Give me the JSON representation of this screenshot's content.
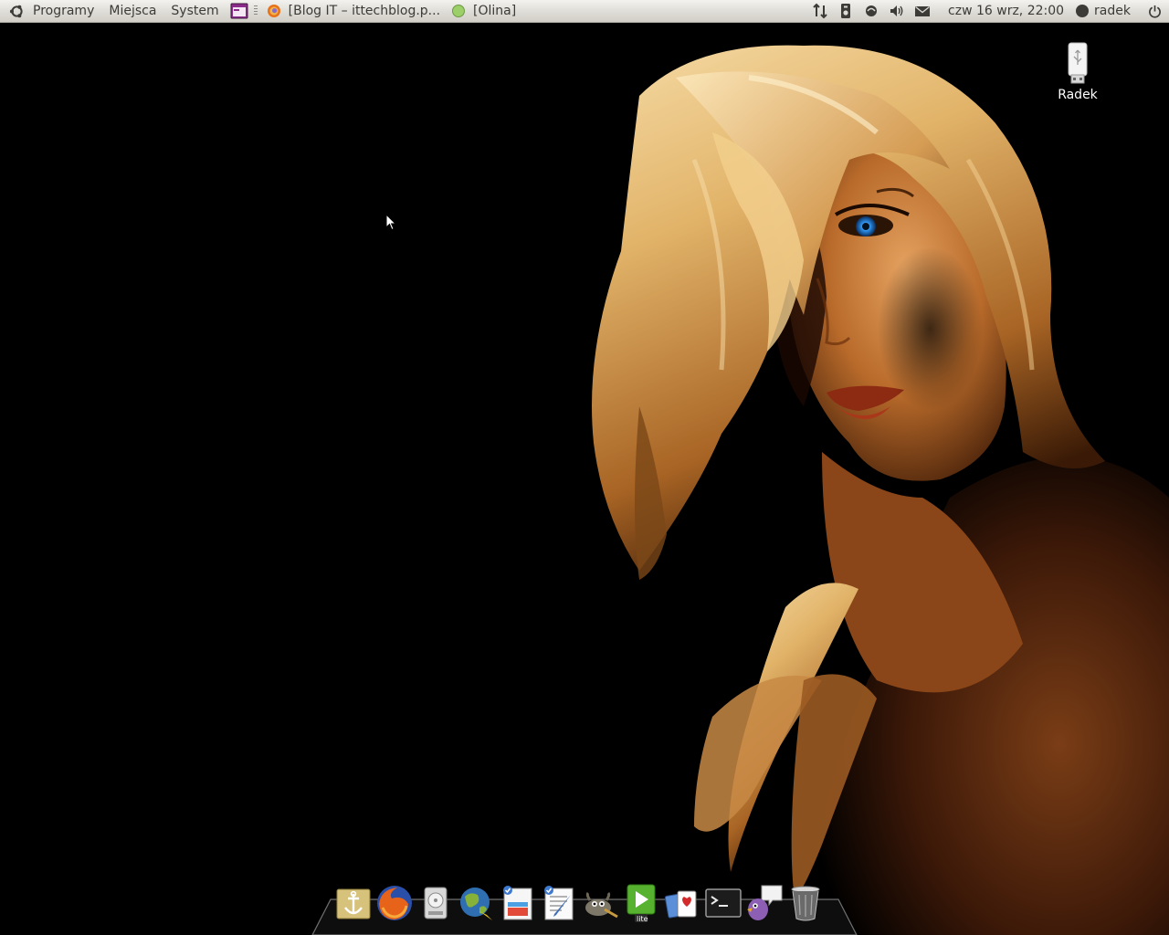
{
  "top_panel": {
    "menus": [
      {
        "label": "Programy"
      },
      {
        "label": "Miejsca"
      },
      {
        "label": "System"
      }
    ],
    "tasks": [
      {
        "label": "[Blog IT – ittechblog.p...",
        "icon": "firefox-icon"
      },
      {
        "label": "[Olina]",
        "icon": "pidgin-status-icon"
      }
    ],
    "tray": [
      "network-transfer-icon",
      "media-player-icon",
      "messaging-icon",
      "volume-icon",
      "mail-icon"
    ],
    "clock": "czw 16 wrz, 22:00",
    "user": "radek"
  },
  "desktop": {
    "icons": [
      {
        "label": "Radek",
        "icon": "usb-drive-icon"
      }
    ]
  },
  "dock": {
    "items": [
      {
        "name": "anchor",
        "icon": "anchor-icon"
      },
      {
        "name": "firefox",
        "icon": "firefox-icon"
      },
      {
        "name": "disk-utility",
        "icon": "harddisk-icon"
      },
      {
        "name": "qgis",
        "icon": "globe-icon"
      },
      {
        "name": "report-tool",
        "icon": "chart-document-icon"
      },
      {
        "name": "text-editor",
        "icon": "text-editor-icon"
      },
      {
        "name": "gimp",
        "icon": "gimp-icon"
      },
      {
        "name": "lite-player",
        "icon": "play-lite-icon"
      },
      {
        "name": "card-game",
        "icon": "cards-icon"
      },
      {
        "name": "terminal",
        "icon": "terminal-icon"
      },
      {
        "name": "pidgin",
        "icon": "pidgin-icon"
      },
      {
        "name": "trash",
        "icon": "trash-icon"
      }
    ],
    "lite_badge": "lite"
  },
  "colors": {
    "panel_bg": "#dedcd6",
    "panel_text": "#3c3b37",
    "hair": "#e8c079",
    "skin": "#b4672c",
    "desktop_bg": "#000000"
  }
}
